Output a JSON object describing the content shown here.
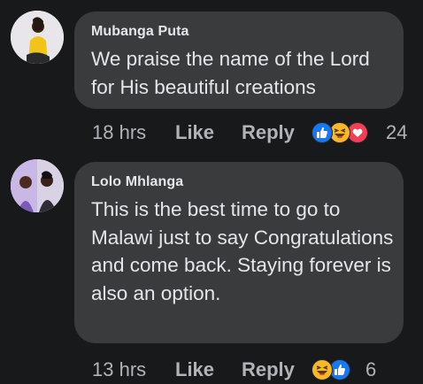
{
  "comments": [
    {
      "author": "Mubanga Puta",
      "text": "We praise the name of the Lord for His beautiful creations",
      "time": "18 hrs",
      "like_label": "Like",
      "reply_label": "Reply",
      "reactions": [
        "like-icon",
        "laugh-icon",
        "love-icon"
      ],
      "reaction_count": "24"
    },
    {
      "author": "Lolo Mhlanga",
      "text": "This is the best time to go to Malawi just to say Congratulations and come back. Staying forever is also an option.",
      "time": "13 hrs",
      "like_label": "Like",
      "reply_label": "Reply",
      "reactions": [
        "laugh-icon",
        "like-icon"
      ],
      "reaction_count": "6"
    }
  ],
  "colors": {
    "background": "#18191a",
    "bubble": "#3a3b3c",
    "primary_text": "#e4e6eb",
    "secondary_text": "#b0b3b8",
    "like_blue": "#1877f2",
    "love_red": "#f33e58",
    "laugh_yellow": "#f7b928"
  }
}
